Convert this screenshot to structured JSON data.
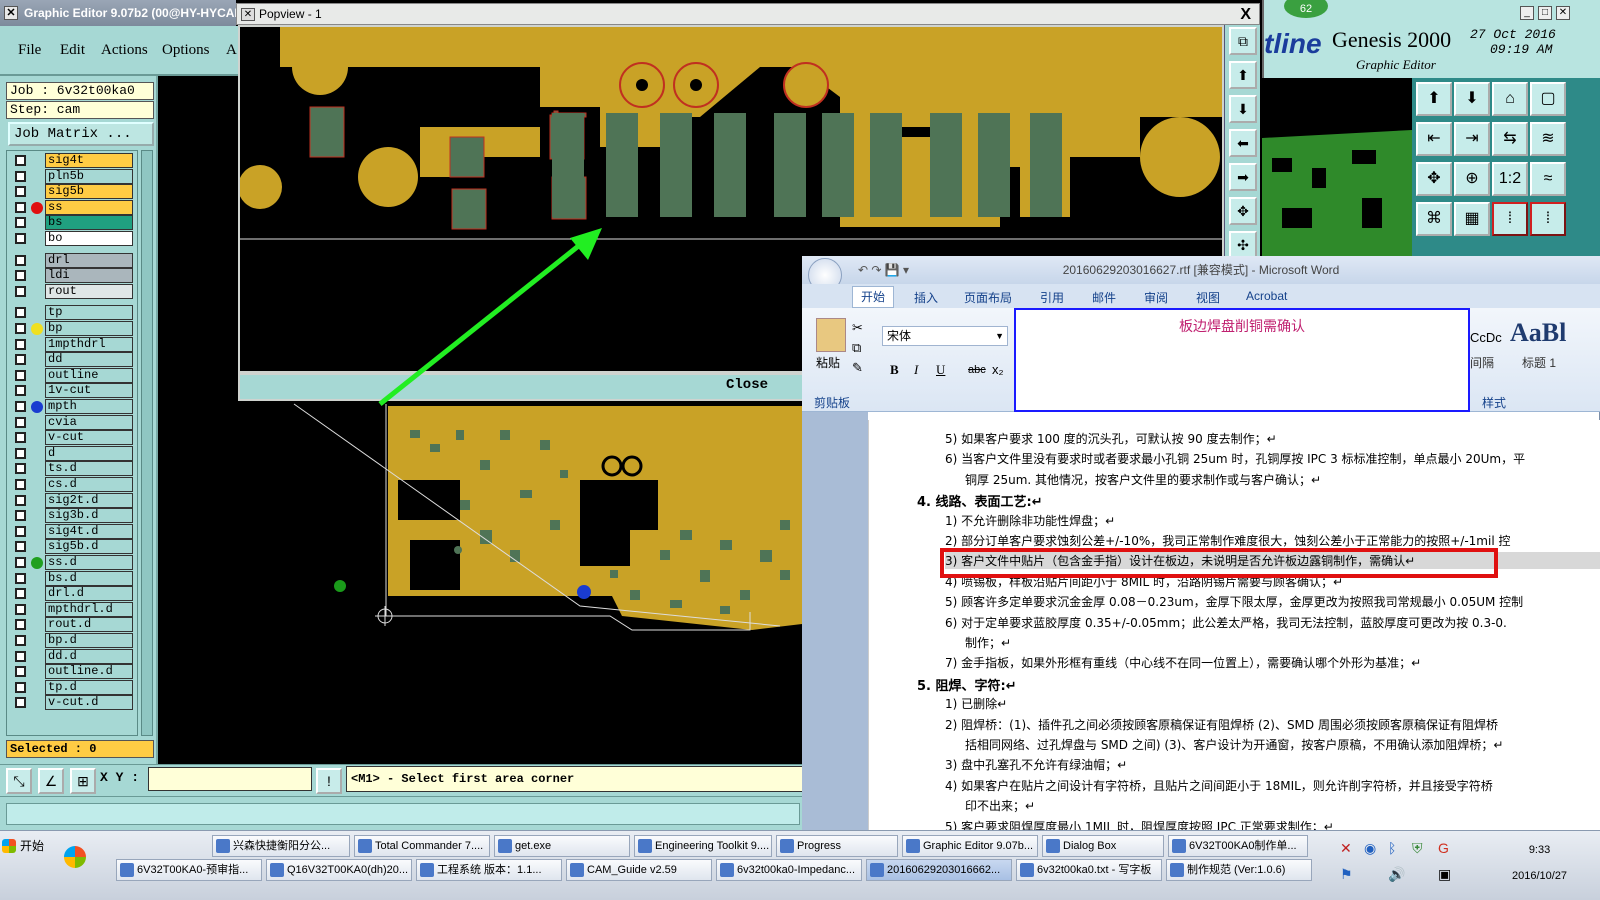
{
  "graphic_editor": {
    "title": "Graphic Editor 9.07b2 (00@HY-HYCAM",
    "menu": [
      "File",
      "Edit",
      "Actions",
      "Options",
      "A"
    ],
    "job": "Job : 6v32t00ka0",
    "step": "Step: cam",
    "job_matrix": "Job Matrix ...",
    "layers": [
      "sig4t",
      "pln5b",
      "sig5b",
      "ss",
      "bs",
      "bo",
      "drl",
      "ldi",
      "rout",
      "tp",
      "bp",
      "1mpthdrl",
      "dd",
      "outline",
      "1v-cut",
      "mpth",
      "cvia",
      "v-cut",
      "d",
      "ts.d",
      "cs.d",
      "sig2t.d",
      "sig3b.d",
      "sig4t.d",
      "sig5b.d",
      "ss.d",
      "bs.d",
      "drl.d",
      "mpthdrl.d",
      "rout.d",
      "bp.d",
      "dd.d",
      "outline.d",
      "tp.d",
      "v-cut.d"
    ],
    "selected": "Selected : 0",
    "xy_label": "X Y :",
    "xy_value": "",
    "prompt": "<M1> - Select first area corner",
    "colors": {
      "panel": "#a6d8d4",
      "copper": "#c9a226",
      "pad": "#4f7456"
    }
  },
  "popview": {
    "title": "Popview - 1",
    "close_label": "Close",
    "close_x": "X"
  },
  "genesis": {
    "badge": "62",
    "logo": "tline",
    "title": "Genesis 2000",
    "subtitle": "Graphic Editor",
    "date": "27 Oct 2016",
    "time": "09:19 AM"
  },
  "word": {
    "title": "20160629203016627.rtf [兼容模式] - Microsoft Word",
    "tabs": [
      "开始",
      "插入",
      "页面布局",
      "引用",
      "邮件",
      "审阅",
      "视图",
      "Acrobat"
    ],
    "paste": "粘贴",
    "clipboard": "剪贴板",
    "font": "宋体",
    "styles": "样式",
    "style_preview": "AaBl",
    "style_label": "标题 1",
    "style_left": "CcDc",
    "style_left_label": "间隔",
    "comment": "板边焊盘削铜需确认",
    "lines": [
      "5) 如果客户要求 100 度的沉头孔，可默认按 90 度去制作；↵",
      "6) 当客户文件里没有要求时或者要求最小孔铜 25um 时，孔铜厚按 IPC 3 标标准控制，单点最小 20Um，平",
      "铜厚 25um. 其他情况，按客户文件里的要求制作或与客户确认；↵",
      "4.  线路、表面工艺:↵",
      "1) 不允许删除非功能性焊盘；↵",
      "2) 部分订单客户要求蚀刻公差+/-10%，我司正常制作难度很大，蚀刻公差小于正常能力的按照+/-1mil 控",
      "3) 客户文件中贴片（包含金手指）设计在板边，未说明是否允许板边露铜制作，需确认↵",
      "4) 喷锡板，样板沿贴片间距小于 8MIL 时，沿路阴锡片需要与顾客确认；↵",
      "5) 顾客许多定单要求沉金金厚 0.08－0.23um，金厚下限太厚，金厚更改为按照我司常规最小 0.05UM 控制",
      "6) 对于定单要求蓝胶厚度 0.35+/-0.05mm；此公差太严格，我司无法控制，蓝胶厚度可更改为按 0.3-0.",
      "制作；↵",
      "7) 金手指板，如果外形框有重线（中心线不在同一位置上），需要确认哪个外形为基准；↵",
      "5.  阻焊、字符:↵",
      "1) 已删除↵",
      "2) 阻焊桥：(1)、插件孔之间必须按顾客原稿保证有阻焊桥 (2)、SMD 周围必须按顾客原稿保证有阻焊桥",
      "括相同网络、过孔焊盘与 SMD 之间) (3)、客户设计为开通窗，按客户原稿，不用确认添加阻焊桥；↵",
      "3) 盘中孔塞孔不允许有绿油帽；↵",
      "4) 如果客户在贴片之间设计有字符桥，且贴片之间间距小于 18MIL，则允许削字符桥，并且接受字符桥",
      "印不出来；↵",
      "5) 客户要求阻焊厚度最小 1MIL 时，阻焊厚度按照 IPC 正常要求制作；↵"
    ]
  },
  "taskbar": {
    "start": "开始",
    "row1": [
      "兴森快捷衡阳分公...",
      "Total Commander 7....",
      "get.exe",
      "Engineering Toolkit 9....",
      "Progress",
      "Graphic Editor 9.07b...",
      "Dialog Box",
      "6V32T00KA0制作单..."
    ],
    "row2": [
      "6V32T00KA0-预审指...",
      "Q16V32T00KA0(dh)20...",
      "工程系统  版本：1.1...",
      "CAM_Guide v2.59",
      "6v32t00ka0-Impedanc...",
      "20160629203016662...",
      "6v32t00ka0.txt - 写字板",
      "制作规范 (Ver:1.0.6)"
    ],
    "time": "9:33",
    "date": "2016/10/27"
  }
}
